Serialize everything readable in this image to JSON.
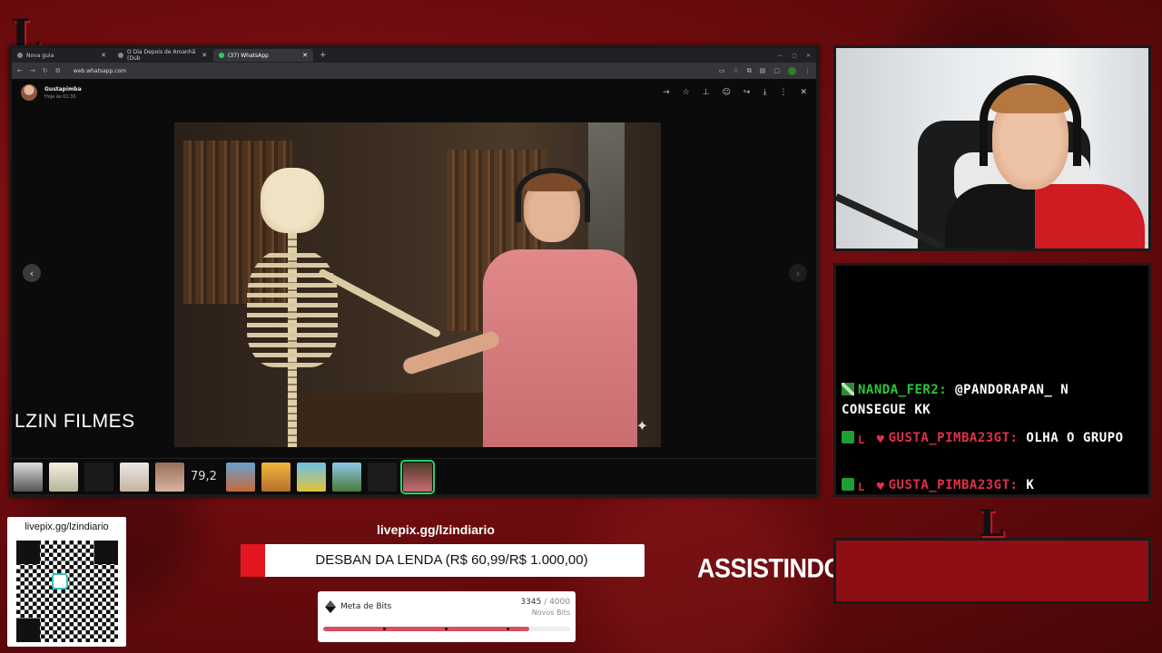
{
  "browser": {
    "tabs": [
      {
        "label": "Nova guia",
        "active": false
      },
      {
        "label": "O Dia Depois de Amanhã (Dub",
        "active": false
      },
      {
        "label": "(37) WhatsApp",
        "active": true
      }
    ],
    "new_tab": "+",
    "url": "web.whatsapp.com"
  },
  "viewer": {
    "sender_name": "Gustapimba",
    "sent_time": "Hoje às 01:30",
    "overlay_label": "LZIN FILMES",
    "thumb_text": "79,2"
  },
  "chat": {
    "messages": [
      {
        "badges": [
          "sword-badge"
        ],
        "user": "NANDA_FER2:",
        "user_color": "#28c836",
        "text": "@PANDORAPAN_ N CONSEGUE KK"
      },
      {
        "badges": [
          "check-badge",
          "l-badge",
          "heart-badge"
        ],
        "user": "GUSTA_PIMBA23GT:",
        "user_color": "#e0304a",
        "text": "OLHA O GRUPO"
      },
      {
        "badges": [
          "check-badge",
          "l-badge",
          "heart-badge"
        ],
        "user": "GUSTA_PIMBA23GT:",
        "user_color": "#e0304a",
        "text": "K"
      }
    ]
  },
  "qr": {
    "url": "livepix.gg/lzindiario"
  },
  "goal": {
    "url": "livepix.gg/lzindiario",
    "text": "DESBAN DA LENDA (R$ 60,99/R$ 1.000,00)",
    "progress": 0.061
  },
  "bits": {
    "label": "Meta de Bits",
    "current": "3345",
    "total": "/ 4000",
    "sub": "Novos Bits",
    "progress": 0.836
  },
  "watching_label": "ASSISTINDO:",
  "logo_letter": "L",
  "colors": {
    "accent_red": "#e4161f",
    "whatsapp_green": "#25d366"
  }
}
